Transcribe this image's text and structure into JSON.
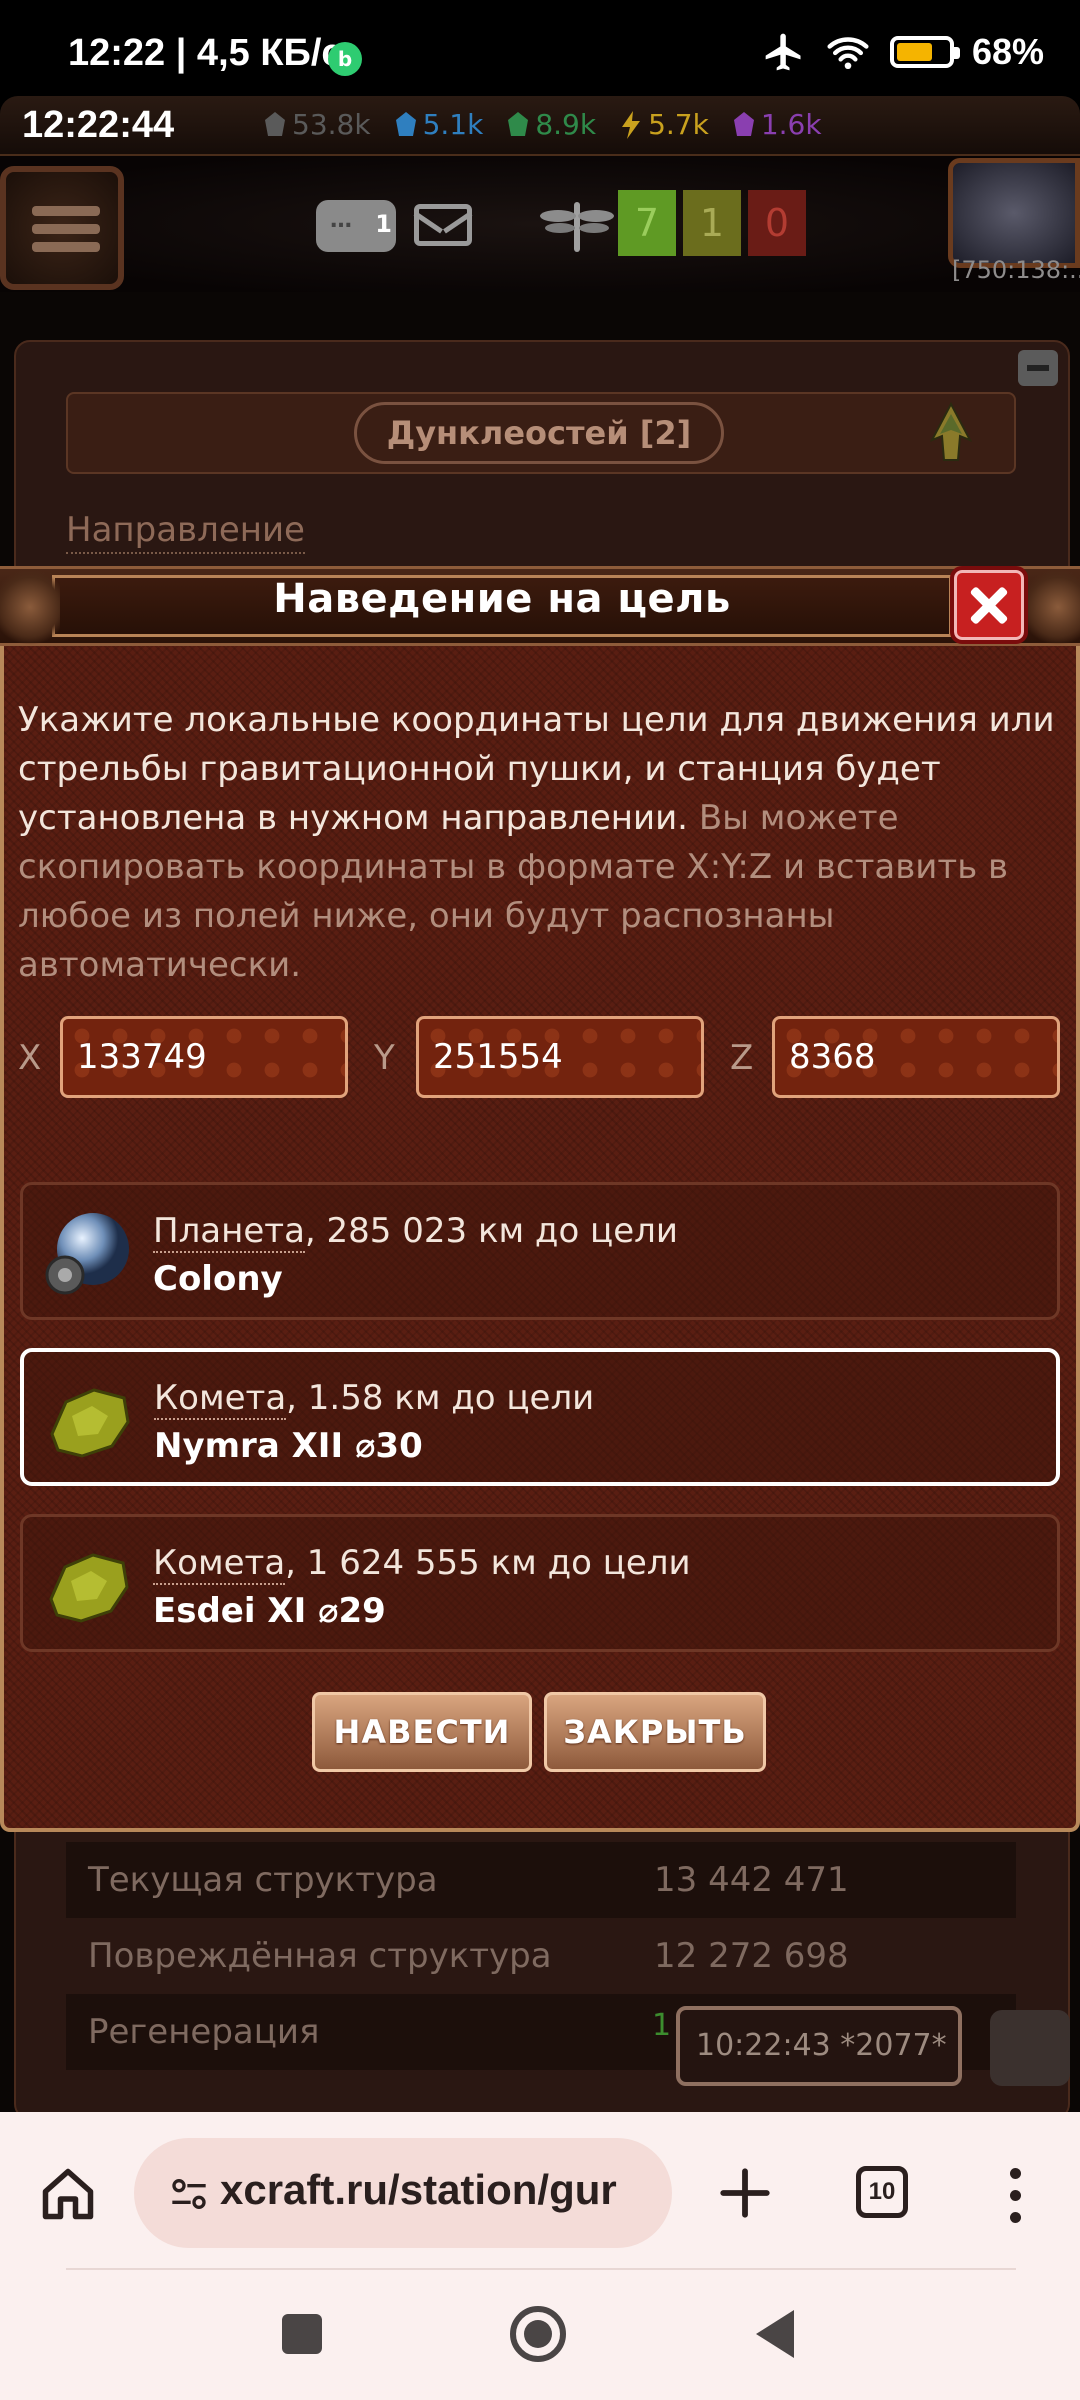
{
  "status_bar": {
    "time_speed": "12:22 | 4,5 КБ/с",
    "battery_percent": "68%",
    "battery_level": 0.68
  },
  "game": {
    "clock": "12:22:44",
    "resources": [
      {
        "name": "metal",
        "value": "53.8k",
        "color": "#5a5a5a"
      },
      {
        "name": "crystal",
        "value": "5.1k",
        "color": "#2f7fbf"
      },
      {
        "name": "deuterium",
        "value": "8.9k",
        "color": "#2f8a4a"
      },
      {
        "name": "energy",
        "value": "5.7k",
        "color": "#c9a11e"
      },
      {
        "name": "dark-matter",
        "value": "1.6k",
        "color": "#8a3fb0"
      }
    ],
    "chat_badge": "1",
    "counters": {
      "green": "7",
      "olive": "1",
      "red": "0"
    },
    "coords_mini": "[750:138:..."
  },
  "station": {
    "ship_name": "Дунклеостей [2]",
    "direction_label": "Направление",
    "stats": [
      {
        "label": "Текущая структура",
        "value": "13 442 471"
      },
      {
        "label": "Повреждённая структура",
        "value": "12 272 698"
      },
      {
        "label": "Регенерация",
        "value": ""
      }
    ],
    "timer": "10:22:43   *2077*",
    "green_digit": "1"
  },
  "modal": {
    "title": "Наведение на цель",
    "desc_main": "Укажите локальные координаты цели для движения или стрельбы гравитационной пушки, и станция будет установлена в нужном направлении.",
    "desc_muted": "Вы можете скопировать координаты в формате X:Y:Z и вставить в любое из полей ниже, они будут распознаны автоматически.",
    "coords": {
      "x_label": "X",
      "x_value": "133749",
      "y_label": "Y",
      "y_value": "251554",
      "z_label": "Z",
      "z_value": "8368"
    },
    "targets": [
      {
        "kind": "Планета",
        "distance": ", 285 023 км до цели",
        "name": "Colony",
        "icon": "planet-icon",
        "selected": false
      },
      {
        "kind": "Комета",
        "distance": ", 1.58 км до цели",
        "name": "Nymra XII ⌀30",
        "icon": "comet-icon",
        "selected": true
      },
      {
        "kind": "Комета",
        "distance": ", 1 624 555 км до цели",
        "name": "Esdei XI ⌀29",
        "icon": "comet-icon",
        "selected": false
      }
    ],
    "buttons": {
      "aim": "НАВЕСТИ",
      "close": "ЗАКРЫТЬ"
    }
  },
  "browser": {
    "url": "xcraft.ru/station/gur",
    "tab_count": "10"
  }
}
